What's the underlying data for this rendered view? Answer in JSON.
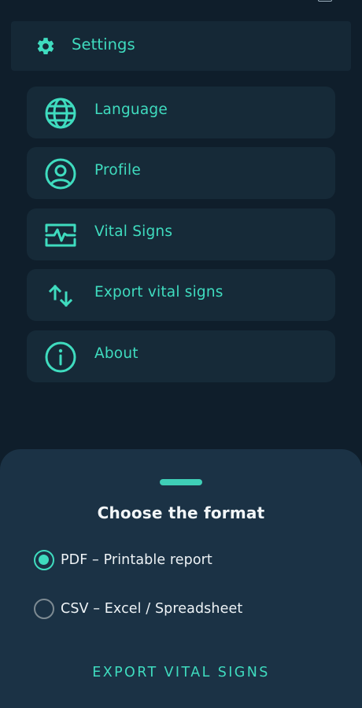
{
  "colors": {
    "accent": "#3fdcbf",
    "background": "#0f1e2b",
    "card": "#162a38",
    "sheet": "#1b3245"
  },
  "settings_header": {
    "label": "Settings",
    "icon": "gear-icon"
  },
  "menu": {
    "items": [
      {
        "label": "Language",
        "icon": "globe-icon"
      },
      {
        "label": "Profile",
        "icon": "user-circle-icon"
      },
      {
        "label": "Vital Signs",
        "icon": "pulse-monitor-icon"
      },
      {
        "label": "Export vital signs",
        "icon": "swap-vertical-icon"
      },
      {
        "label": "About",
        "icon": "info-icon"
      }
    ]
  },
  "sheet": {
    "title": "Choose the format",
    "options": [
      {
        "label": "PDF – Printable report",
        "selected": true
      },
      {
        "label": "CSV – Excel / Spreadsheet",
        "selected": false
      }
    ],
    "export_label": "EXPORT VITAL SIGNS"
  }
}
